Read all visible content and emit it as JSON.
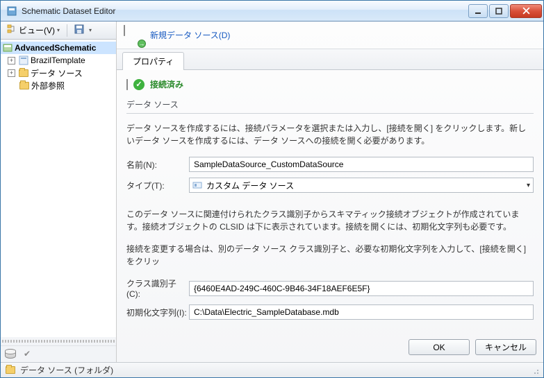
{
  "window": {
    "title": "Schematic Dataset Editor"
  },
  "left_toolbar": {
    "view_label": "ビュー(V)"
  },
  "tree": {
    "items": [
      {
        "label": "AdvancedSchematic"
      },
      {
        "label": "BrazilTemplate"
      },
      {
        "label": "データ ソース"
      },
      {
        "label": "外部参照"
      }
    ]
  },
  "right_head": {
    "new_datasource": "新規データ ソース(D)"
  },
  "tabs": {
    "properties": "プロパティ"
  },
  "status": {
    "connected": "接続済み"
  },
  "group": {
    "datasource": "データ ソース"
  },
  "paras": {
    "p1": "データ ソースを作成するには、接続パラメータを選択または入力し、[接続を開く] をクリックします。新しいデータ ソースを作成するには、データ ソースへの接続を開く必要があります。",
    "p2": "このデータ ソースに関連付けられたクラス識別子からスキマティック接続オブジェクトが作成されています。接続オブジェクトの CLSID は下に表示されています。接続を開くには、初期化文字列も必要です。",
    "p3": "接続を変更する場合は、別のデータ ソース クラス識別子と、必要な初期化文字列を入力して、[接続を開く] をクリッ"
  },
  "form": {
    "name_label": "名前(N):",
    "name_value": "SampleDataSource_CustomDataSource",
    "type_label": "タイプ(T):",
    "type_value": "カスタム データ ソース",
    "clsid_label": "クラス識別子(C):",
    "clsid_value": "{6460E4AD-249C-460C-9B46-34F18AEF6E5F}",
    "init_label": "初期化文字列(I):",
    "init_value": "C:\\Data\\Electric_SampleDatabase.mdb"
  },
  "buttons": {
    "ok": "OK",
    "cancel": "キャンセル"
  },
  "statusbar": {
    "text": "データ ソース (フォルダ)"
  }
}
